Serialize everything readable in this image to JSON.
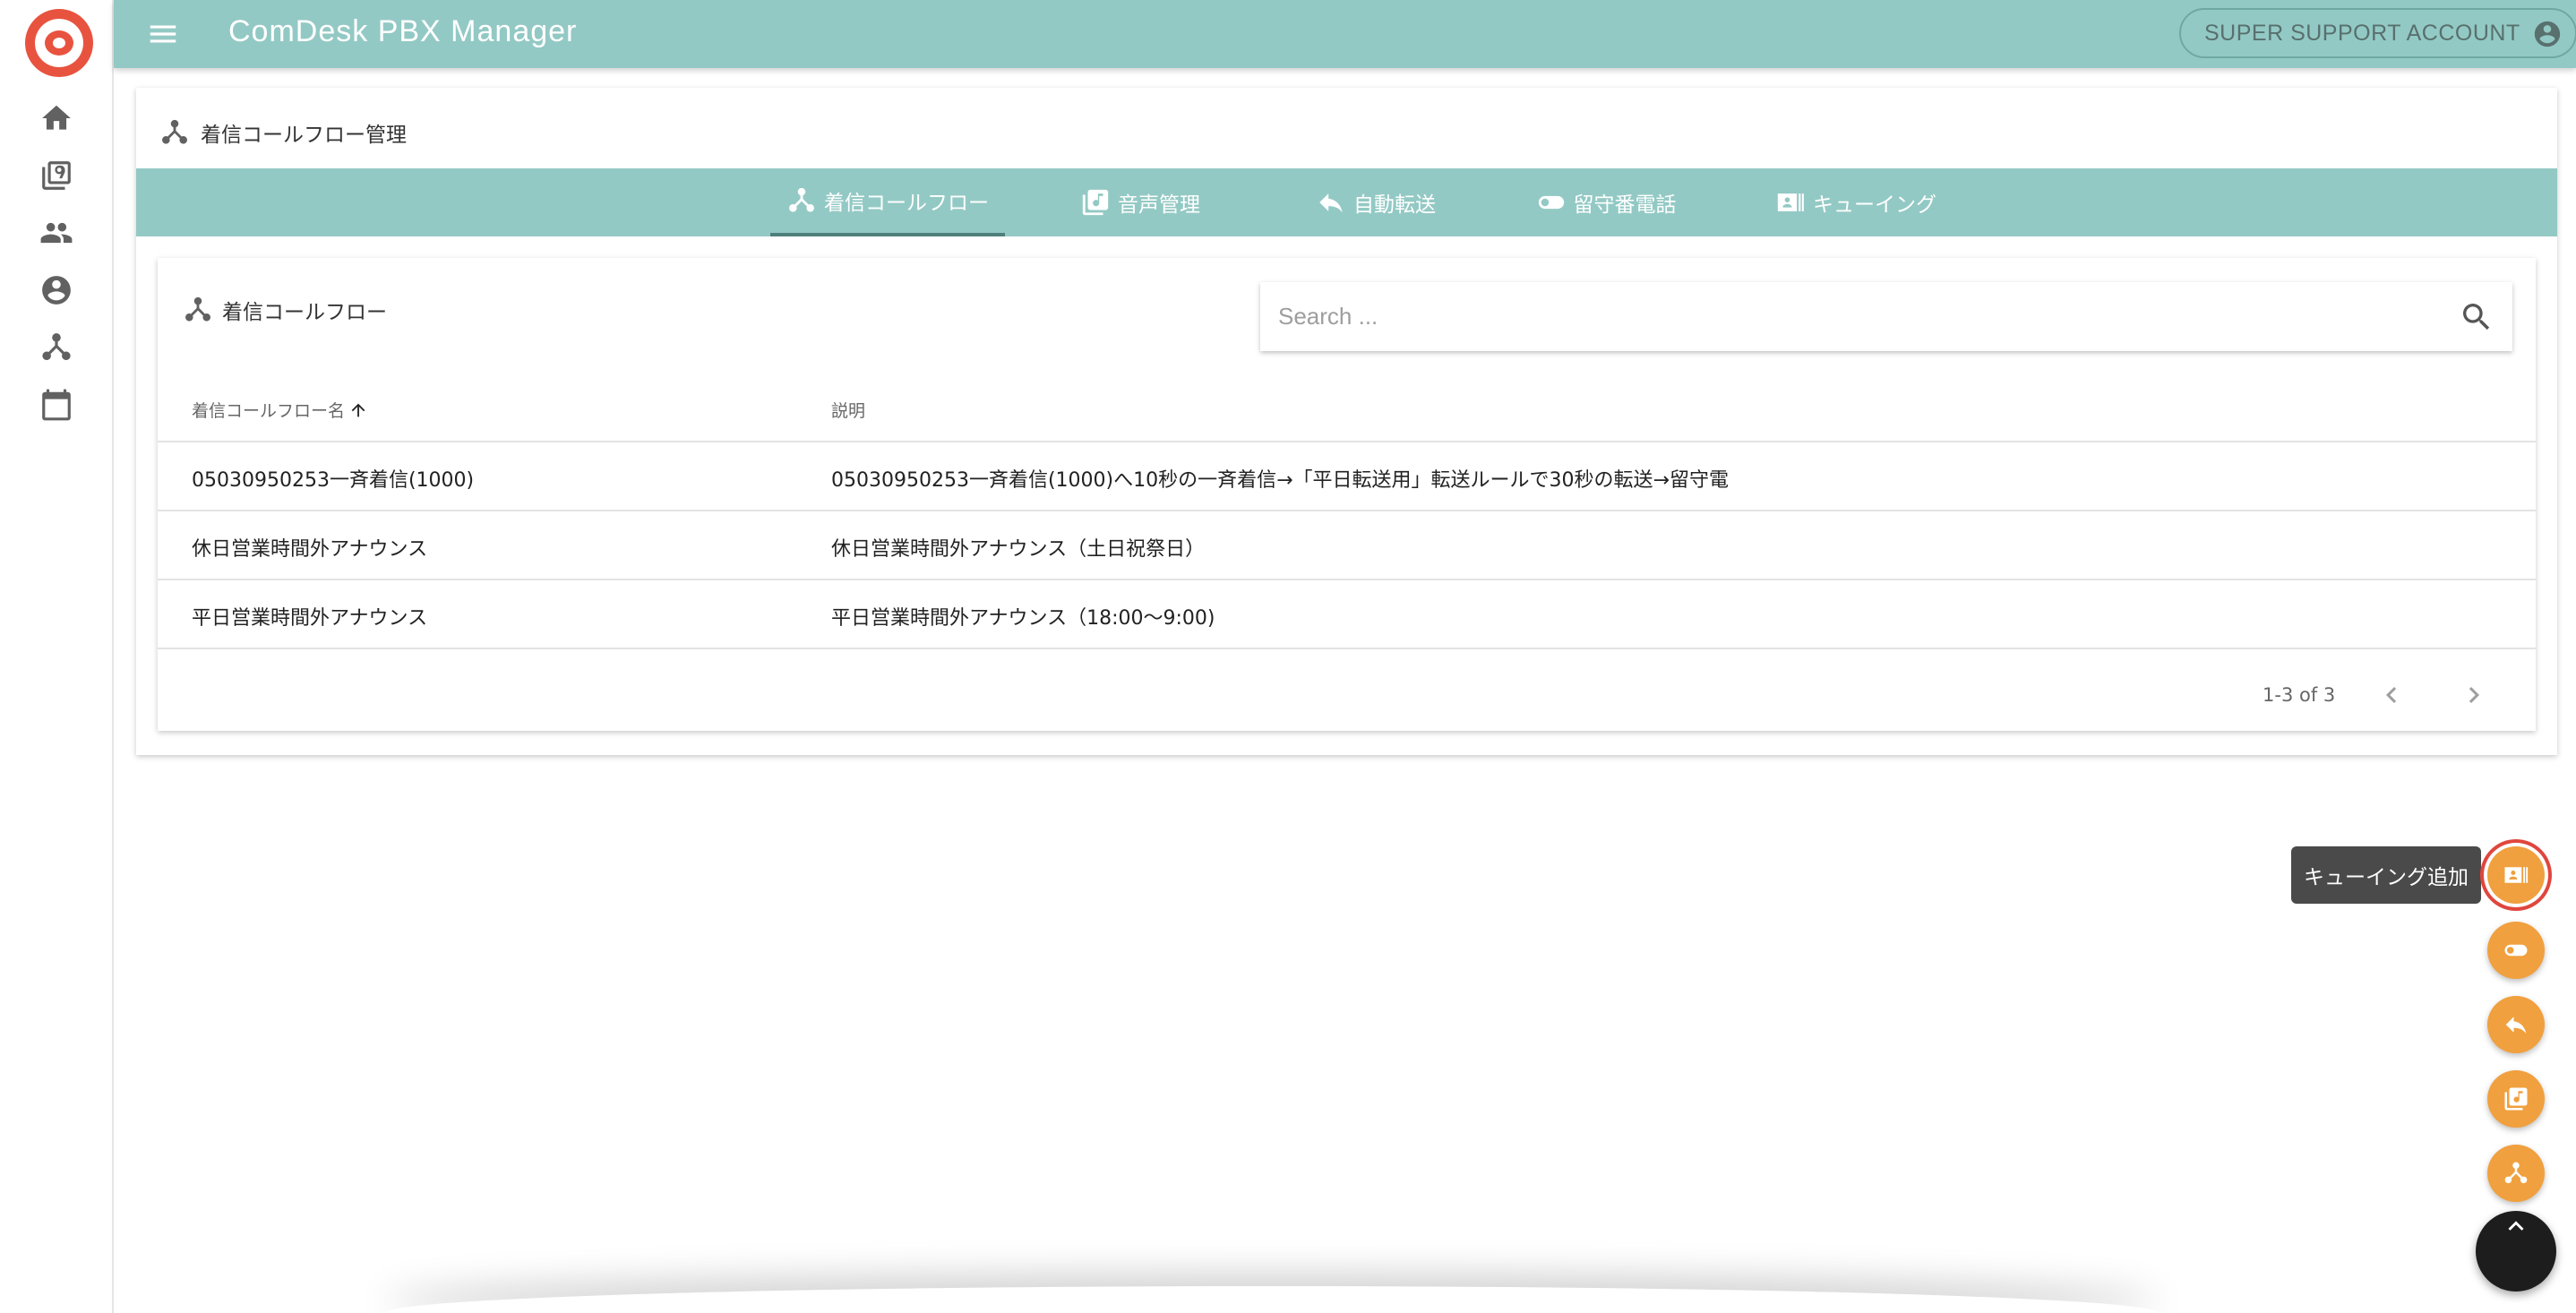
{
  "app": {
    "title": "ComDesk PBX Manager",
    "account_label": "SUPER SUPPORT ACCOUNT"
  },
  "rail": {
    "items": [
      {
        "icon": "home-icon"
      },
      {
        "icon": "phonebook-icon"
      },
      {
        "icon": "people-icon"
      },
      {
        "icon": "account-circle-icon"
      },
      {
        "icon": "call-flow-icon"
      },
      {
        "icon": "calendar-icon"
      }
    ]
  },
  "page": {
    "title": "着信コールフロー管理"
  },
  "tabs": [
    {
      "label": "着信コールフロー",
      "icon": "call-flow-icon",
      "active": true
    },
    {
      "label": "音声管理",
      "icon": "audio-library-icon",
      "active": false
    },
    {
      "label": "自動転送",
      "icon": "reply-icon",
      "active": false
    },
    {
      "label": "留守番電話",
      "icon": "toggle-icon",
      "active": false
    },
    {
      "label": "キューイング",
      "icon": "queue-card-icon",
      "active": false
    }
  ],
  "list": {
    "title": "着信コールフロー",
    "search_placeholder": "Search ...",
    "columns": {
      "name": "着信コールフロー名",
      "description": "説明"
    },
    "rows": [
      {
        "name": "05030950253一斉着信(1000)",
        "description": "05030950253一斉着信(1000)へ10秒の一斉着信→「平日転送用」転送ルールで30秒の転送→留守電"
      },
      {
        "name": "休日営業時間外アナウンス",
        "description": "休日営業時間外アナウンス（土日祝祭日）"
      },
      {
        "name": "平日営業時間外アナウンス",
        "description": "平日営業時間外アナウンス（18:00〜9:00)"
      }
    ],
    "pagination": "1-3 of 3"
  },
  "speed_dial": {
    "tooltip": "キューイング追加",
    "actions": [
      {
        "icon": "queue-card-icon"
      },
      {
        "icon": "toggle-icon"
      },
      {
        "icon": "reply-icon"
      },
      {
        "icon": "audio-library-icon"
      },
      {
        "icon": "call-flow-icon"
      }
    ],
    "main_icon": "chevron-up-icon"
  },
  "colors": {
    "teal": "#93c9c4",
    "orange": "#f0a03e",
    "logo_red": "#e8533f"
  }
}
